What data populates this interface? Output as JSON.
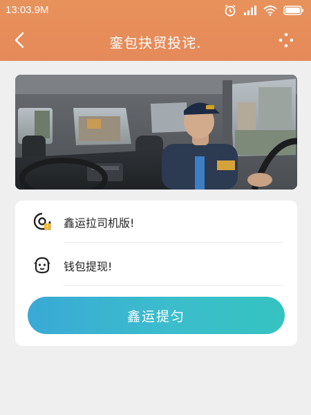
{
  "status_bar": {
    "time": "13:03.9M",
    "icons": [
      "alarm-icon",
      "signal-icon",
      "wifi-icon",
      "battery-icon"
    ]
  },
  "header": {
    "title": "銮包抉贸投诧.",
    "back_icon": "back-chevron-icon",
    "more_icon": "more-dots-icon"
  },
  "banner": {
    "image": "driver-in-truck-cab-photo"
  },
  "menu": {
    "items": [
      {
        "label": "鑫运拉司机版!",
        "icon": "driver-app-icon"
      },
      {
        "label": "钱包提现!",
        "icon": "wallet-face-icon"
      }
    ]
  },
  "cta": {
    "label": "鑫运提匀"
  },
  "colors": {
    "header": "#e5895a",
    "background": "#efefef",
    "cta_start": "#3aa9d6",
    "cta_end": "#35c3c0",
    "card": "#ffffff"
  }
}
